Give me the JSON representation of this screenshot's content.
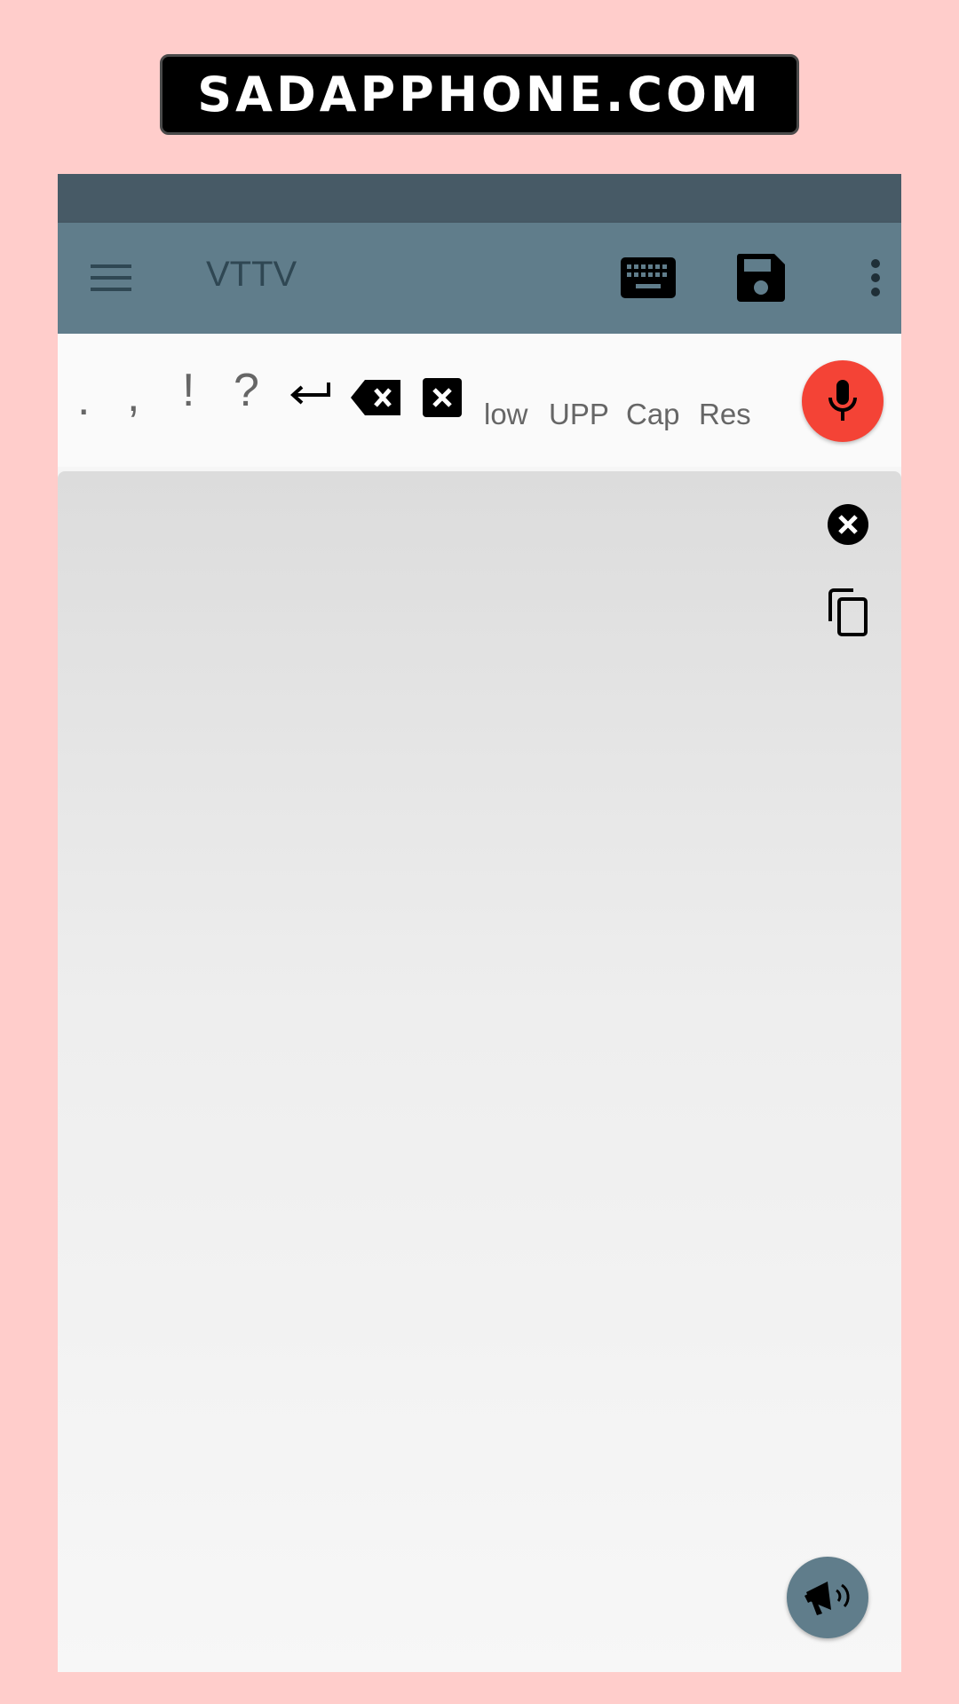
{
  "watermark": {
    "text": "SADAPPHONE.COM"
  },
  "toolbar": {
    "title": "VTTV",
    "icons": {
      "menu": "hamburger-menu-icon",
      "keyboard": "keyboard-icon",
      "save": "floppy-disk-icon",
      "more": "more-vert-icon"
    }
  },
  "punctuation": {
    "period": ".",
    "comma": ",",
    "exclamation": "!",
    "question": "?"
  },
  "case_buttons": {
    "lower": "low",
    "upper": "UPP",
    "capitalize": "Cap",
    "reset": "Res"
  },
  "colors": {
    "toolbar": "#607d8b",
    "statusbar": "#475a66",
    "mic": "#f44336",
    "background": "#ffcdcb"
  }
}
